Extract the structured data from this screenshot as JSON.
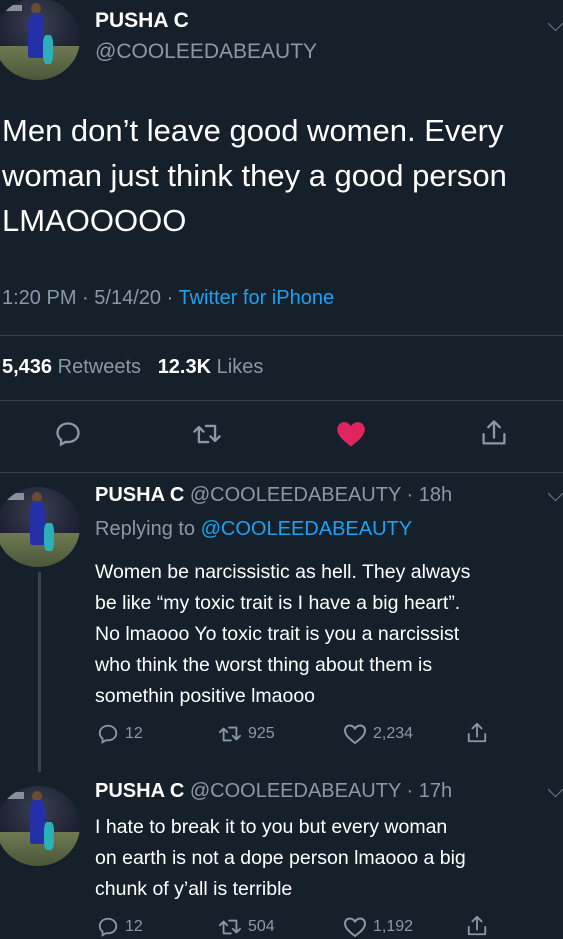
{
  "main_tweet": {
    "display_name": "PUSHA C",
    "handle": "@COOLEEDABEAUTY",
    "text_lines": [
      "Men don’t leave good women. Every",
      "woman just think they a good person",
      "LMAOOOOO"
    ],
    "time": "1:20 PM",
    "date": "5/14/20",
    "sep": "·",
    "source": "Twitter for iPhone",
    "retweets_count": "5,436",
    "retweets_label": "Retweets",
    "likes_count": "12.3K",
    "likes_label": "Likes"
  },
  "colors": {
    "background": "#15202b",
    "link": "#1da1f2",
    "muted": "#8899a6",
    "like": "#e0245e"
  },
  "icons": [
    "reply-icon",
    "retweet-icon",
    "heart-icon",
    "share-icon"
  ],
  "replies": [
    {
      "display_name": "PUSHA C",
      "handle": "@COOLEEDABEAUTY",
      "age": "18h",
      "replying_prefix": "Replying to",
      "replying_to": "@COOLEEDABEAUTY",
      "text_lines": [
        "Women be narcissistic as hell. They always",
        "be like “my toxic trait is I have a big heart”.",
        "No lmaooo Yo toxic trait is you a narcissist",
        "who think the worst thing about them is",
        "somethin positive lmaooo"
      ],
      "replies_count": "12",
      "retweets_count": "925",
      "likes_count": "2,234"
    },
    {
      "display_name": "PUSHA C",
      "handle": "@COOLEEDABEAUTY",
      "age": "17h",
      "text_lines": [
        "I hate to break it to you but every woman",
        "on earth is not a dope person lmaooo a big",
        "chunk of y’all is terrible"
      ],
      "replies_count": "12",
      "retweets_count": "504",
      "likes_count": "1,192"
    }
  ]
}
